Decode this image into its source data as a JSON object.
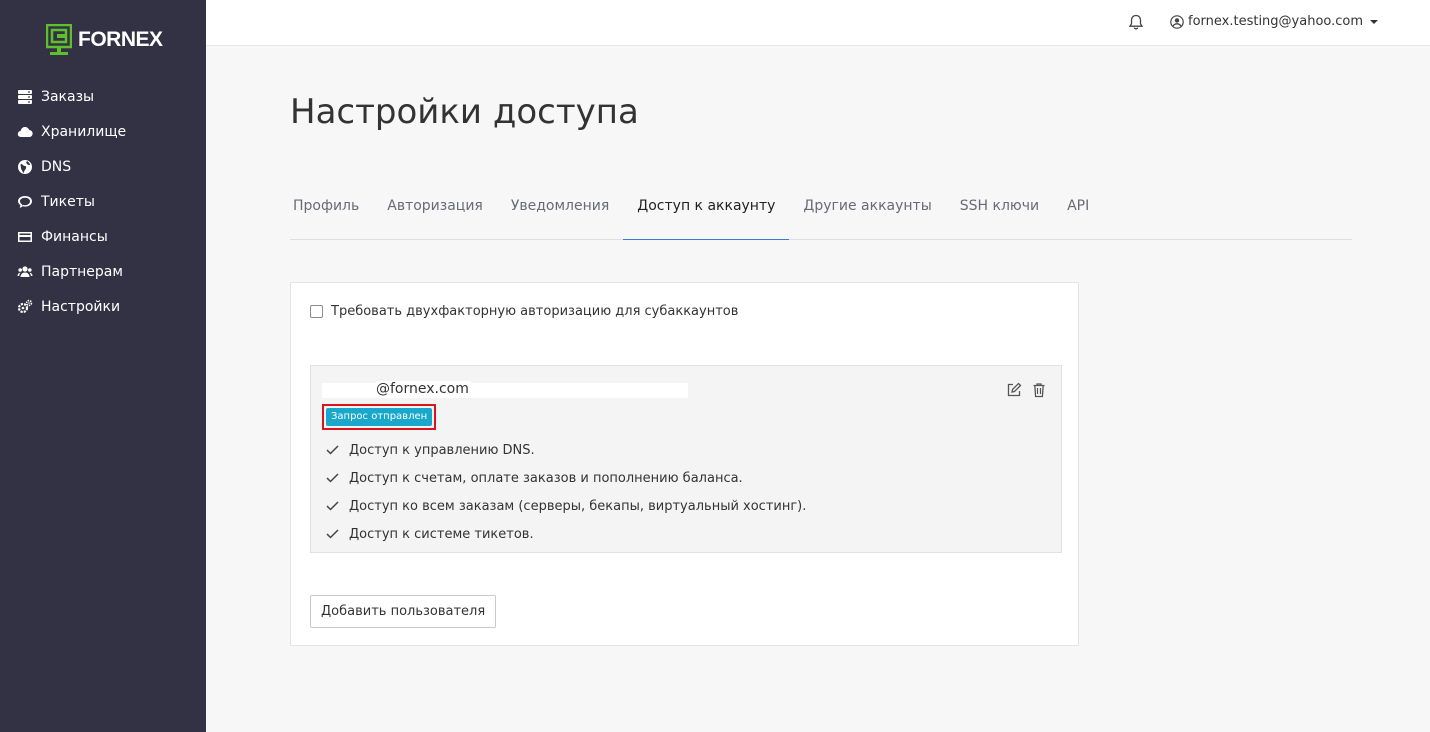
{
  "brand": {
    "logo_text": "FORNEX",
    "accent": "#5fbf2c"
  },
  "sidebar": {
    "bg": "#323244",
    "items": [
      {
        "label": "Заказы",
        "icon": "server-icon"
      },
      {
        "label": "Хранилище",
        "icon": "cloud-icon"
      },
      {
        "label": "DNS",
        "icon": "globe-icon"
      },
      {
        "label": "Тикеты",
        "icon": "chat-icon"
      },
      {
        "label": "Финансы",
        "icon": "credit-card-icon"
      },
      {
        "label": "Партнерам",
        "icon": "users-icon"
      },
      {
        "label": "Настройки",
        "icon": "gears-icon"
      }
    ]
  },
  "header": {
    "user_email": "fornex.testing@yahoo.com"
  },
  "page": {
    "title": "Настройки доступа"
  },
  "tabs": [
    {
      "label": "Профиль",
      "active": false
    },
    {
      "label": "Авторизация",
      "active": false
    },
    {
      "label": "Уведомления",
      "active": false
    },
    {
      "label": "Доступ к аккаунту",
      "active": true
    },
    {
      "label": "Другие аккаунты",
      "active": false
    },
    {
      "label": "SSH ключи",
      "active": false
    },
    {
      "label": "API",
      "active": false
    }
  ],
  "settings": {
    "require_2fa_label": "Требовать двухфакторную авторизацию для субаккаунтов",
    "require_2fa_checked": false
  },
  "subaccount": {
    "email": "@fornex.com",
    "status_badge": "Запрос отправлен",
    "badge_color": "#19a8cc",
    "permissions": [
      "Доступ к управлению DNS.",
      "Доступ к счетам, оплате заказов и пополнению баланса.",
      "Доступ ко всем заказам (серверы, бекапы, виртуальный хостинг).",
      "Доступ к системе тикетов."
    ]
  },
  "add_user_label": "Добавить пользователя"
}
